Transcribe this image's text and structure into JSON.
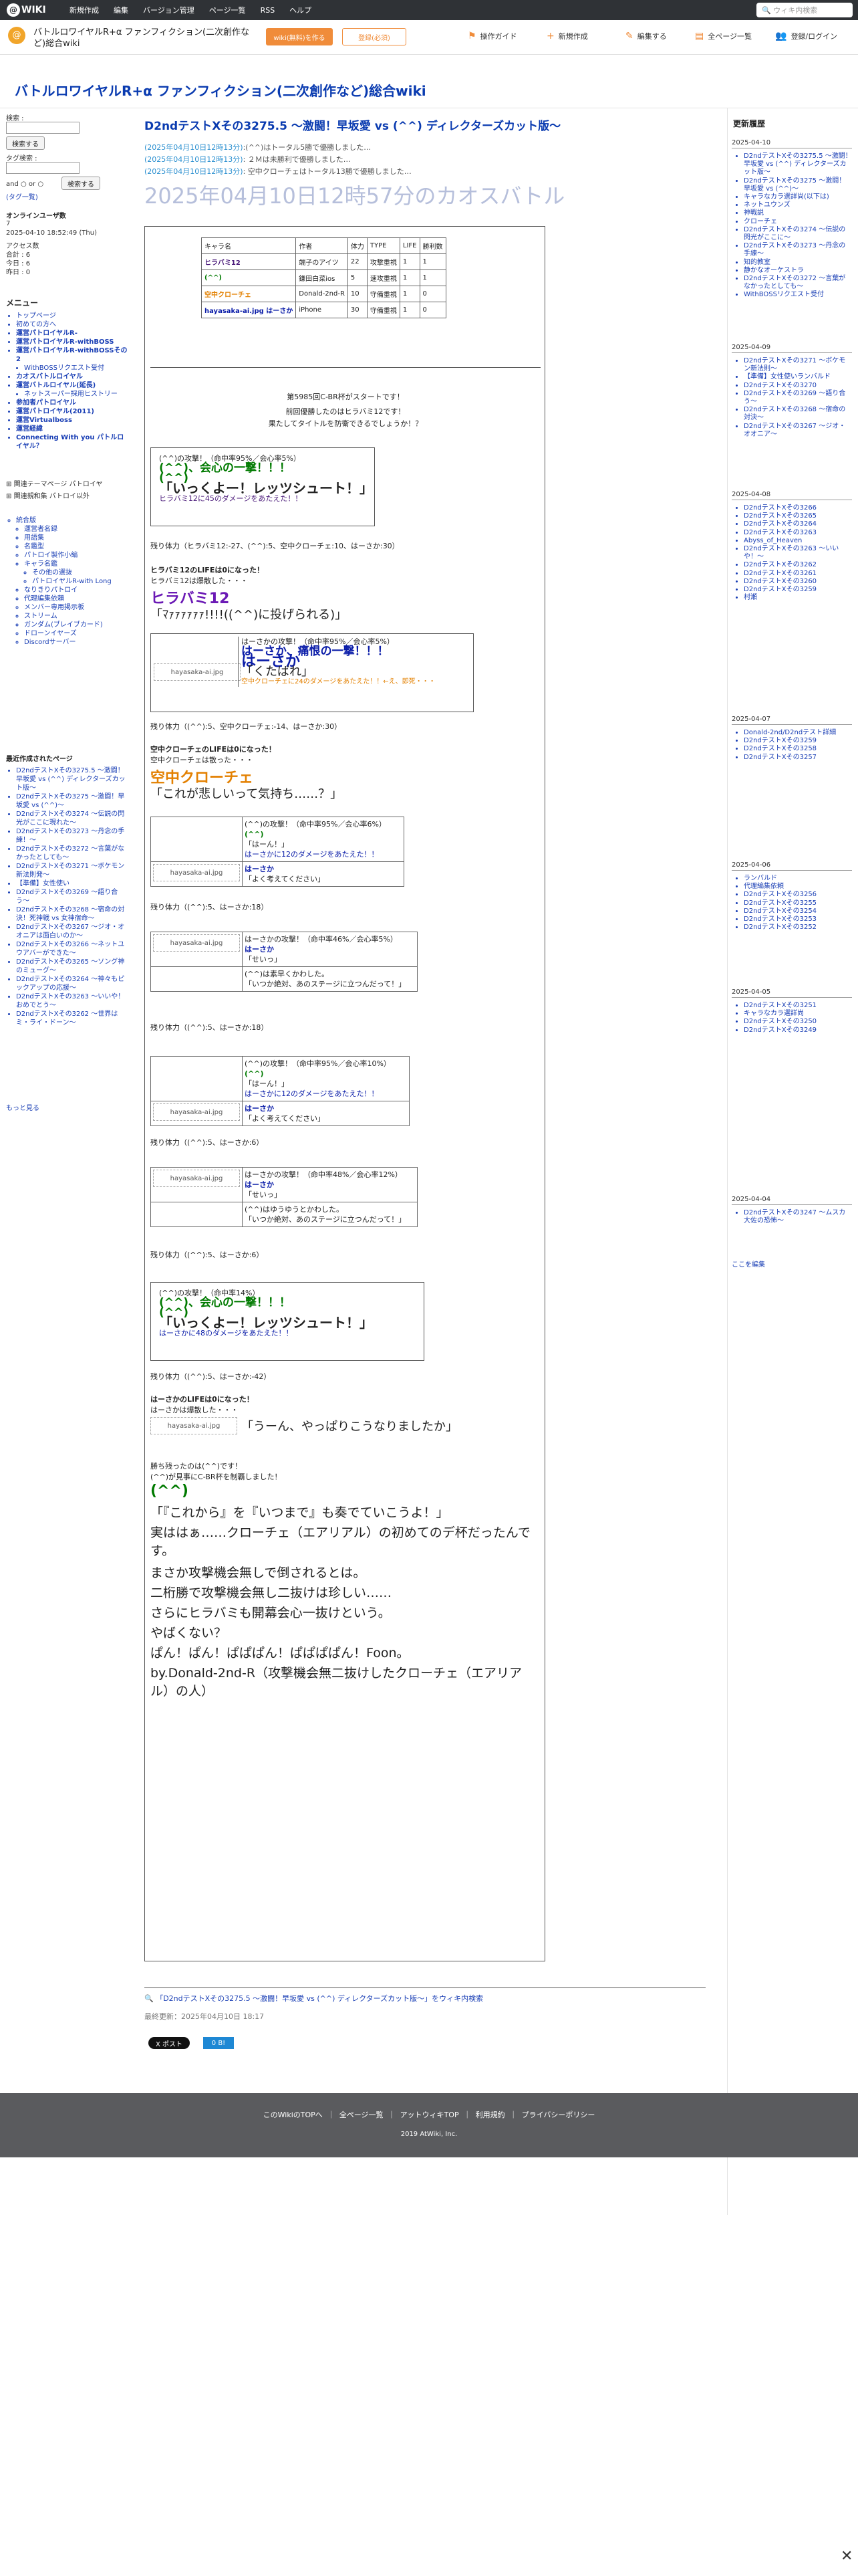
{
  "topbar": {
    "logo": "WIKI",
    "menu": [
      "新規作成",
      "編集",
      "バージョン管理",
      "ページ一覧",
      "RSS",
      "ヘルプ"
    ],
    "search_placeholder": "ウィキ内検索"
  },
  "header": {
    "wiki_name": "バトルロワイヤルR+α ファンフィクション(二次創作など)総合wiki",
    "btn1": "wiki(無料)を作る",
    "btn2": "登録(必須)",
    "tools": [
      "操作ガイド",
      "新規作成",
      "編集する",
      "全ページ一覧",
      "登録/ログイン"
    ]
  },
  "page_title": "バトルロワイヤルR+α ファンフィクション(二次創作など)総合wiki",
  "left": {
    "search_label": "検索 :",
    "search_btn": "検索する",
    "tag_label": "タグ検索 :",
    "tag_btn": "検索する",
    "and": "and",
    "or": "or",
    "tag_cloud": "(タグ一覧)",
    "online_title": "オンラインユーザ数",
    "online_count": "7",
    "datetime": "2025-04-10 18:52:49 (Thu)",
    "access_label": "アクセス数",
    "total": "合計 : 6",
    "today": "今日 : 6",
    "yesterday": "昨日 : 0",
    "menu_title": "メニュー",
    "menu": [
      "トップページ",
      "初めての方へ",
      "運営パトロイヤルR-",
      "運営パトロイヤルR-withBOSS",
      "運営パトロイヤルR-withBOSSその2",
      "WithBOSSリクエスト受付",
      "カオスバトルロイヤル",
      "運営バトルロイヤル(延長)",
      "ネットスーパー採用ヒストリー",
      "参加者パトロイヤル",
      "運営パトロイヤル(2011)",
      "運営Virtualboss",
      "運営経緯",
      "Connecting With you パトルロイヤル？"
    ],
    "relations": [
      "関連テーマページ パトロイヤ",
      "関連親和集 パトロイ以外"
    ],
    "submenu": [
      "統合版",
      "運営者名録",
      "用語集",
      "名鑑型",
      "パトロイ製作小編",
      "キャラ名鑑",
      "その他の選抜",
      "パトロイヤルR-with Long",
      "なりきりパトロイ",
      "代理編集依頼",
      "メンバー専用掲示板",
      "ストリーム",
      "ガンダム(ブレイブカード)",
      "ドローンイヤーズ",
      "Discordサーバー"
    ],
    "recent_title": "最近作成されたページ",
    "recent": [
      "D2ndテストXその3275.5 〜激闘！早坂愛 vs (^^) ディレクターズカット版〜",
      "D2ndテストXその3275 〜激闘！早坂愛 vs (^^)〜",
      "D2ndテストXその3274 〜伝説の閃光がここに現れた〜",
      "D2ndテストXその3273 〜丹念の手練！〜",
      "D2ndテストXその3272 〜言葉がなかったとしても〜",
      "D2ndテストXその3271 〜ボケモン新法則発〜",
      "【準備】女性使い",
      "D2ndテストXその3269 〜語り合う〜",
      "D2ndテストXその3268 〜宿命の対決！死神戦 vs 女神宿命〜",
      "D2ndテストXその3267 〜ジオ・オオニアは面白いのか〜",
      "D2ndテストXその3266 〜ネットユウアバーができた〜",
      "D2ndテストXその3265 〜ソング神のミューグ〜",
      "D2ndテストXその3264 〜神々もピックアップの応援〜",
      "D2ndテストXその3263 〜いいや！おめでとう〜",
      "D2ndテストXその3262 〜世界はミ・ライ・ドーン〜"
    ],
    "more": "もっと見る"
  },
  "main": {
    "title": "D2ndテストXその3275.5 〜激闘！早坂愛 vs (^^) ディレクターズカット版〜",
    "logs": [
      {
        "time": "(2025年04月10日12時13分)",
        "text": ":(^^)はトータル5勝で優勝しました…"
      },
      {
        "time": "(2025年04月10日12時13分)",
        "text": ": ２Ｍは未勝利で優勝しました…"
      },
      {
        "time": "(2025年04月10日12時13分)",
        "text": ": 空中クローチェはトータル13勝で優勝しました…"
      }
    ],
    "chaos_title": "2025年04月10日12時57分のカオスバトル",
    "table_head": [
      "キャラ名",
      "作者",
      "体力",
      "TYPE",
      "LIFE",
      "勝利数"
    ],
    "table_rows": [
      [
        "ヒラバミ12",
        "端子のアイツ",
        "22",
        "攻撃重視",
        "1",
        "1"
      ],
      [
        "(^^)",
        "鎌田白菜ios",
        "5",
        "速攻重視",
        "1",
        "1"
      ],
      [
        "空中クローチェ",
        "Donald-2nd-R",
        "10",
        "守備重視",
        "1",
        "0"
      ],
      [
        "hayasaka-ai.jpg はーさか",
        "iPhone",
        "30",
        "守備重視",
        "1",
        "0"
      ]
    ],
    "intro1": "第5985回C-BR杯がスタートです！",
    "intro2": "前回優勝したのはヒラバミ12です！",
    "intro3": "果たしてタイトルを防衛できるでしょうか！？",
    "a1_head": "(^^)の攻撃！（命中率95%／会心率5%）",
    "a1_name": "(^^)、会心の一撃！！！",
    "a1_face": "(^^)",
    "a1_speech": "「いっくよー！レッツシュート！」",
    "a1_dmg": "ヒラバミ12に45のダメージをあたえた！！",
    "rem1": "残り体力（ヒラバミ12:-27、(^^):5、空中クローチェ:10、はーさか:30）",
    "lose1": "ヒラバミ12のLIFEは0になった！",
    "lose1b": "ヒラバミ12は爆散した・・・",
    "h12": "ヒラバミ12",
    "h12_speech": "「ﾏｧｧｧｧｧｧ!!!!((^^)に投げられる)」",
    "a2_head": "はーさかの攻撃！（命中率95%／会心率5%）",
    "a2_crit": "はーさか、痛恨の一撃！！！",
    "a2_name": "はーさか",
    "a2_speech": "「くたばれ」",
    "a2_dmg": "空中クローチェに24のダメージをあたえた！！←え、即死・・・",
    "rem2": "残り体力（(^^):5、空中クローチェ:-14、はーさか:30）",
    "lose2": "空中クローチェのLIFEは0になった！",
    "lose2b": "空中クローチェは散った・・・",
    "kc": "空中クローチェ",
    "kc_speech": "「これが悲しいって気持ち……？」",
    "a3_head": "(^^)の攻撃！（命中率95%／会心率6%）",
    "a3_face": "(^^)",
    "a3_say": "「はーん！」",
    "a3_dmg": "はーさかに12のダメージをあたえた！！",
    "h_name": "はーさか",
    "h_reply": "「よく考えてください」",
    "rem3": "残り体力（(^^):5、はーさか:18）",
    "a4_head": "はーさかの攻撃！（命中率46%／会心率5%）",
    "a4_say": "「せいっ」",
    "a4_dodge": "(^^)は素早くかわした。",
    "a4_reply": "「いつか絶対、あのステージに立つんだって！」",
    "rem4": "残り体力（(^^):5、はーさか:18）",
    "a5_head": "(^^)の攻撃！（命中率95%／会心率10%）",
    "a5_dmg": "はーさかに12のダメージをあたえた！！",
    "rem5": "残り体力（(^^):5、はーさか:6）",
    "a6_head": "はーさかの攻撃！（命中率48%／会心率12%）",
    "a6_dodge": "(^^)はゆうゆうとかわした。",
    "rem6": "残り体力（(^^):5、はーさか:6）",
    "a7_head": "(^^)の攻撃！（命中率14%）",
    "a7_dmg": "はーさかに48のダメージをあたえた！！",
    "rem7": "残り体力（(^^):5、はーさか:-42）",
    "lose3": "はーさかのLIFEは0になった！",
    "lose3b": "はーさかは爆散した・・・",
    "final_speech": "「うーん、やっぱりこうなりましたか」",
    "winner1": "勝ち残ったのは(^^)です！",
    "winner2": "(^^)が見事にC-BR杯を制覇しました！",
    "win_face": "(^^)",
    "win_speech": "「『これから』を『いつまで』も奏でていこうよ！」",
    "end1": "実ははぁ……クローチェ（エアリアル）の初めてのデ杯だったんです。",
    "end2": "まさか攻撃機会無しで倒されるとは。",
    "end3": "二桁勝で攻撃機会無し二抜けは珍しい……",
    "end4": "さらにヒラバミも開幕会心一抜けという。",
    "end5": "やばくない？",
    "end6": "ぱん！ぱん！ぱぱぱん！ぱぱぱぱん！Foon。",
    "end7": "by.Donald-2nd-R（攻撃機会無二抜けしたクローチェ（エアリアル）の人）",
    "bottom_search": "「D2ndテストXその3275.5 〜激闘！早坂愛 vs (^^) ディレクターズカット版〜」をウィキ内検索",
    "last_update": "最終更新：2025年04月10日 18:17",
    "share1": "X ポスト",
    "share2": "0 B!"
  },
  "right": {
    "title": "更新履歴",
    "groups": [
      {
        "date": "2025-04-10",
        "items": [
          "D2ndテストXその3275.5 〜激闘！早坂愛 vs (^^) ディレクターズカット版〜",
          "D2ndテストXその3275 〜激闘！早坂愛 vs (^^)〜",
          "キャラなカラ選詳尚(以下は)",
          "ネットユウンズ",
          "神戦説",
          "クローチェ",
          "D2ndテストXその3274 〜伝説の閃光がここに〜",
          "D2ndテストXその3273 〜丹念の手練〜",
          "知的教室",
          "静かなオーケストラ",
          "D2ndテストXその3272 〜言葉がなかったとしても〜",
          "WithBOSSリクエスト受付"
        ]
      },
      {
        "date": "2025-04-09",
        "items": [
          "D2ndテストXその3271 〜ボケモン新法則〜",
          "【準備】女性使いランバルド",
          "D2ndテストXその3270",
          "D2ndテストXその3269 〜語り合う〜",
          "D2ndテストXその3268 〜宿命の対決〜",
          "D2ndテストXその3267 〜ジオ・オオニア〜"
        ]
      },
      {
        "date": "2025-04-08",
        "items": [
          "D2ndテストXその3266",
          "D2ndテストXその3265",
          "D2ndテストXその3264",
          "D2ndテストXその3263",
          "Abyss_of_Heaven",
          "D2ndテストXその3263 〜いいや！〜",
          "D2ndテストXその3262",
          "D2ndテストXその3261",
          "D2ndテストXその3260",
          "D2ndテストXその3259",
          "村瀬"
        ]
      },
      {
        "date": "2025-04-07",
        "items": [
          "Donald-2nd/D2ndテスト詳細",
          "D2ndテストXその3259",
          "D2ndテストXその3258",
          "D2ndテストXその3257"
        ]
      },
      {
        "date": "2025-04-06",
        "items": [
          "ランバルド",
          "代理編集依頼",
          "D2ndテストXその3256",
          "D2ndテストXその3255",
          "D2ndテストXその3254",
          "D2ndテストXその3253",
          "D2ndテストXその3252"
        ]
      },
      {
        "date": "2025-04-05",
        "items": [
          "D2ndテストXその3251",
          "キャラなカラ選詳尚",
          "D2ndテストXその3250",
          "D2ndテストXその3249"
        ]
      },
      {
        "date": "2025-04-04",
        "items": [
          "D2ndテストXその3247 〜ムスカ大佐の恐怖〜"
        ]
      }
    ],
    "more": "ここを編集"
  },
  "footer": {
    "links": [
      "このWikiのTOPへ",
      "全ページ一覧",
      "アットウィキTOP",
      "利用規約",
      "プライバシーポリシー"
    ],
    "copy": "2019 AtWiki, Inc."
  },
  "colors": {
    "topbar": "#2f3236",
    "accent": "#f08c3a",
    "link": "#1a3fb5",
    "title": "#0a3bb0",
    "footer": "#5a5b5e"
  }
}
